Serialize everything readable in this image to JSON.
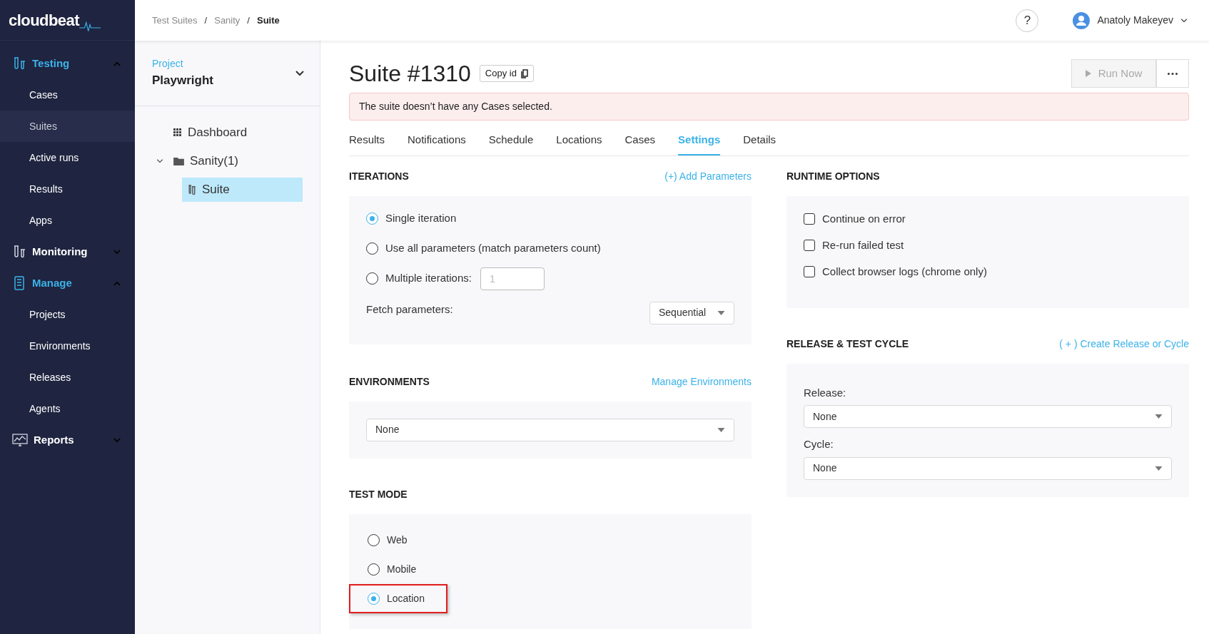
{
  "logo": {
    "text": "cloudbeat"
  },
  "breadcrumbs": [
    {
      "label": "Test Suites",
      "current": false
    },
    {
      "label": "Sanity",
      "current": false
    },
    {
      "label": "Suite",
      "current": true
    }
  ],
  "breadcrumb_separator": "/",
  "header": {
    "help": "?",
    "user": "Anatoly Makeyev"
  },
  "sidebar": {
    "sections": [
      {
        "label": "Testing",
        "kind": "tubes",
        "expanded": true,
        "items": [
          {
            "label": "Cases",
            "selected": false
          },
          {
            "label": "Suites",
            "selected": true
          },
          {
            "label": "Active runs",
            "selected": false
          },
          {
            "label": "Results",
            "selected": false
          },
          {
            "label": "Apps",
            "selected": false
          }
        ]
      },
      {
        "label": "Monitoring",
        "kind": "tubes",
        "expanded": false
      },
      {
        "label": "Manage",
        "kind": "list",
        "expanded": true,
        "items": [
          {
            "label": "Projects",
            "selected": false
          },
          {
            "label": "Environments",
            "selected": false
          },
          {
            "label": "Releases",
            "selected": false
          },
          {
            "label": "Agents",
            "selected": false
          }
        ]
      },
      {
        "label": "Reports",
        "kind": "chart",
        "expanded": false
      }
    ]
  },
  "project": {
    "label": "Project",
    "name": "Playwright"
  },
  "tree": [
    {
      "label": "Dashboard",
      "kind": "dashboard",
      "selected": false
    },
    {
      "label": "Sanity(1)",
      "kind": "folder",
      "selected": false,
      "expanded": true,
      "children": [
        {
          "label": "Suite",
          "kind": "suite",
          "selected": true
        }
      ]
    }
  ],
  "suite": {
    "title": "Suite #1310",
    "copy_button": "Copy id",
    "run_button": {
      "label": "Run Now",
      "disabled": true
    },
    "alert": "The suite doesn’t have any Cases selected."
  },
  "tabs": [
    {
      "label": "Results",
      "selected": false
    },
    {
      "label": "Notifications",
      "selected": false
    },
    {
      "label": "Schedule",
      "selected": false
    },
    {
      "label": "Locations",
      "selected": false
    },
    {
      "label": "Cases",
      "selected": false
    },
    {
      "label": "Settings",
      "selected": true
    },
    {
      "label": "Details",
      "selected": false
    }
  ],
  "iterations": {
    "title": "ITERATIONS",
    "link": "(+) Add Parameters",
    "options": [
      {
        "label": "Single iteration",
        "selected": true,
        "kind": "plain"
      },
      {
        "label": "Use all parameters (match parameters count)",
        "selected": false,
        "kind": "plain"
      },
      {
        "label": "Multiple iterations:",
        "selected": false,
        "kind": "count",
        "placeholder": "1"
      }
    ],
    "fetch": {
      "label": "Fetch parameters:",
      "value": "Sequential"
    }
  },
  "environments": {
    "title": "ENVIRONMENTS",
    "link": "Manage Environments",
    "value": "None"
  },
  "test_mode": {
    "title": "TEST MODE",
    "options": [
      {
        "label": "Web",
        "selected": false,
        "highlighted": false
      },
      {
        "label": "Mobile",
        "selected": false,
        "highlighted": false
      },
      {
        "label": "Location",
        "selected": true,
        "highlighted": true
      }
    ]
  },
  "runtime": {
    "title": "RUNTIME OPTIONS",
    "options": [
      {
        "label": "Continue on error",
        "checked": false
      },
      {
        "label": "Re-run failed test",
        "checked": false
      },
      {
        "label": "Collect browser logs (chrome only)",
        "checked": false
      }
    ]
  },
  "release": {
    "title": "RELEASE & TEST CYCLE",
    "link": "( + ) Create Release or Cycle",
    "fields": [
      {
        "label": "Release:",
        "value": "None"
      },
      {
        "label": "Cycle:",
        "value": "None"
      }
    ]
  }
}
